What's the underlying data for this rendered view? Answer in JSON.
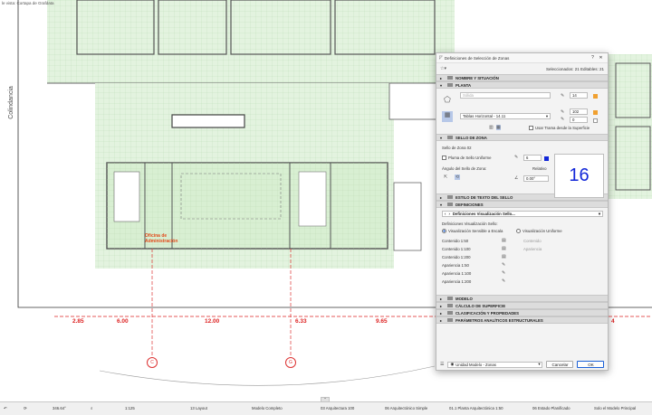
{
  "canvas": {
    "top_caption": "le vista: Cortapa de Grafdata",
    "side_label": "Colindancia",
    "room_label_line1": "Oficina de",
    "room_label_line2": "Administración",
    "dimensions": [
      "2.85",
      "6.00",
      "12.00",
      "6.33",
      "9.65",
      "4"
    ],
    "grid_bubbles": [
      "C",
      "G"
    ]
  },
  "dialog": {
    "title": "Definiciones de Selección de Zonas",
    "selected_text": "Seleccionados: 21 Editables: 21",
    "sections": {
      "nombre": "NOMBRE Y SITUACIÓN",
      "planta": "PLANTA",
      "sello": "SELLO DE ZONA",
      "estilo": "ESTILO DE TEXTO DEL SELLO",
      "definiciones": "DEFINICIONES",
      "modelo": "MODELO",
      "calculo": "CÁLCULO DE SUPERFICIE",
      "clasificacion": "CLASIFICACIÓN Y PROPIEDADES",
      "parametros": "PARÁMETROS ANALÍTICOS ESTRUCTURALES"
    },
    "planta": {
      "fill_placeholder": "Sólida",
      "pen_value_1": "14",
      "pen_value_2": "102",
      "pen_value_3": "0",
      "fill_name": "Tablas Horizontal - 14.11",
      "use_surface_label": "Usar Trama desde la Superficie"
    },
    "sello": {
      "stamp_label": "Sello de Zona 02",
      "uniform_pen_label": "Pluma de Sello Uniforme",
      "pen_value": "6",
      "stamp_preview": "16",
      "angle_label": "Ángulo del Sello de Zona:",
      "relative_label": "Relativo",
      "angle_value": "0.00°"
    },
    "definiciones": {
      "dropdown": "Definiciones Visualización Sello...",
      "vis_label": "Definiciones Visualización Sello:",
      "radio_scale": "Visualización Sensible a Escala",
      "radio_uniform": "Visualización Uniforme",
      "rows": [
        "Contenido 1:50",
        "Contenido 1:100",
        "Contenido 1:200",
        "Apariencia 1:50",
        "Apariencia 1:100",
        "Apariencia 1:200"
      ],
      "right_contenido": "Contenido",
      "right_apariencia": "Apariencia"
    },
    "footer": {
      "layer": "Unidad Modelo - Zonas",
      "cancel": "Cancelar",
      "ok": "OK"
    }
  },
  "statusbar": {
    "items": [
      "346.64°",
      "1:125",
      "13 Layout",
      "Modelo Completo",
      "03 Arquitectura 100",
      "06 Arquitectónico Simple",
      "01.1 Planta Arquitectónica 1:50",
      "06 Estado Planificado",
      "Solo el Modelo Principal"
    ]
  },
  "colors": {
    "accent": "#1a5fd6",
    "stamp_number": "#1227d8",
    "dimension": "#dd2222",
    "zone_fill": "#e3f3df"
  }
}
